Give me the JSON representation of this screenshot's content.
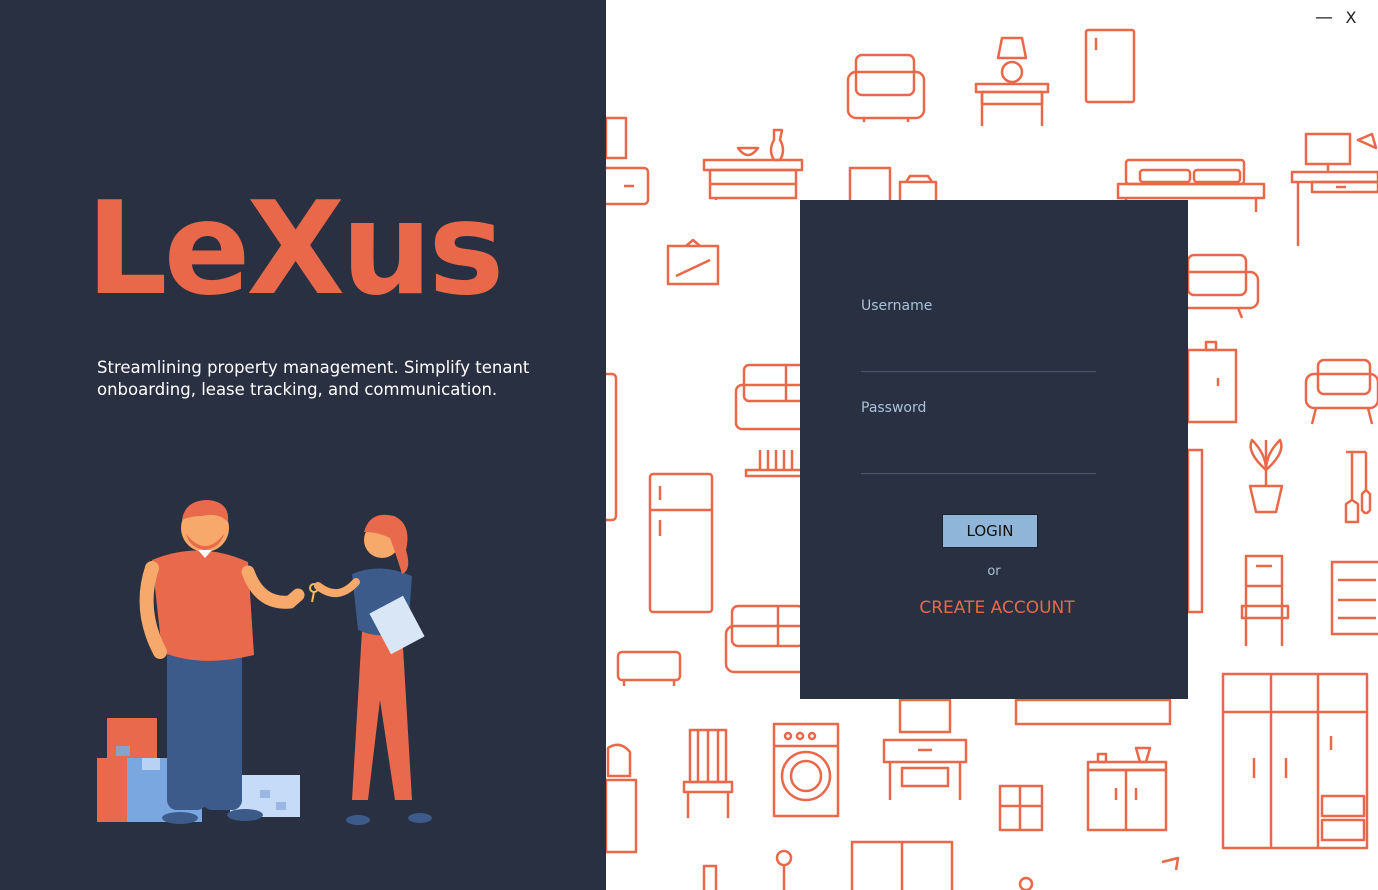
{
  "window": {
    "minimize_label": "—",
    "close_label": "X"
  },
  "brand": {
    "name": "LeXus",
    "tagline": "Streamlining property management. Simplify tenant onboarding, lease tracking, and communication.",
    "accent_color": "#ea684a",
    "dark_color": "#283041"
  },
  "login": {
    "username_label": "Username",
    "username_placeholder": "______________________________",
    "password_label": "Password",
    "password_placeholder": "______________________________",
    "login_button": "LOGIN",
    "or_text": "or",
    "create_account": "CREATE ACCOUNT"
  },
  "illustration": {
    "name": "landlord-handing-keys-illustration"
  },
  "background_pattern": {
    "name": "furniture-pattern-background"
  }
}
